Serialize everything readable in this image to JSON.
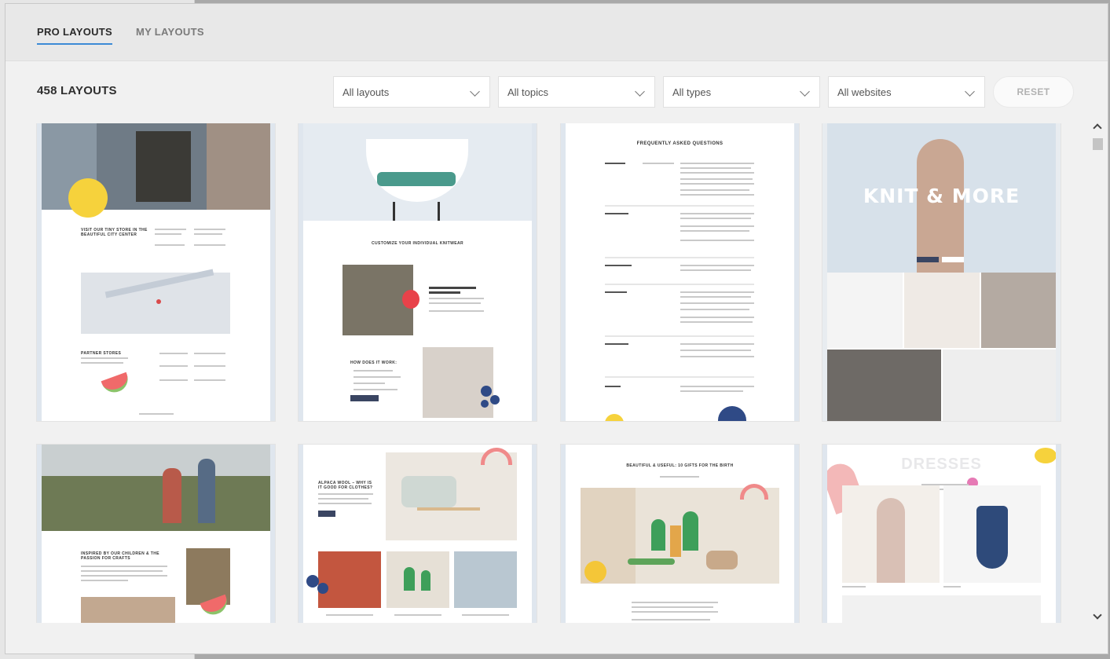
{
  "tabs": {
    "pro": "PRO LAYOUTS",
    "my": "MY LAYOUTS"
  },
  "toolbar": {
    "count": "458 LAYOUTS",
    "filters": [
      "All layouts",
      "All topics",
      "All types",
      "All websites"
    ],
    "reset": "RESET"
  },
  "cards": {
    "faq_title": "FREQUENTLY ASKED QUESTIONS",
    "knit_title": "KNIT & MORE",
    "customize_title": "CUSTOMIZE YOUR INDIVIDUAL KNITWEAR",
    "store_title": "VISIT OUR TINY STORE IN THE BEAUTIFUL CITY CENTER",
    "inspired_title": "INSPIRED BY OUR CHILDREN & THE PASSION FOR CRAFTS",
    "alpaca_title": "ALPACA WOOL – WHY IS IT GOOD FOR CLOTHES?",
    "gifts_title": "BEAUTIFUL & USEFUL: 10 GIFTS FOR THE BIRTH",
    "dresses_title": "DRESSES"
  },
  "colors": {
    "accent": "#3c8ad6",
    "dark_button": "#3a4562"
  }
}
